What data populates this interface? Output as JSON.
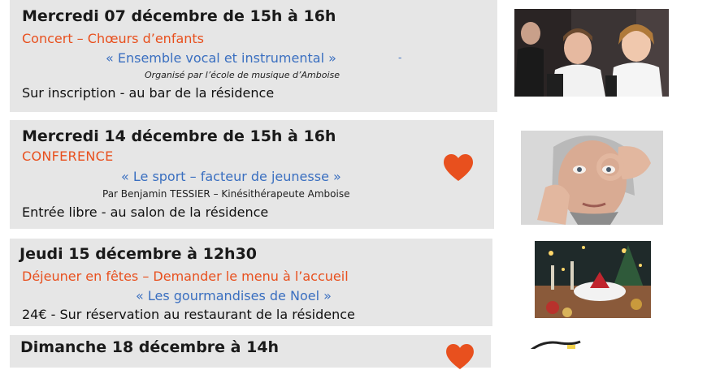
{
  "events": [
    {
      "date": "Mercredi 07 décembre de 15h à 16h",
      "subtitle": "Concert – Chœurs d’enfants",
      "quote": "« Ensemble vocal et instrumental »",
      "organizer": "Organisé par l’école de musique d’Amboise",
      "info": "Sur inscription - au bar de la résidence"
    },
    {
      "date": "Mercredi 14 décembre de 15h à 16h",
      "subtitle": "CONFERENCE",
      "quote": "« Le sport – facteur de jeunesse »",
      "organizer": "Par Benjamin TESSIER – Kinésithérapeute Amboise",
      "info": "Entrée libre - au salon de la résidence"
    },
    {
      "date": "Jeudi 15 décembre à 12h30",
      "subtitle": "Déjeuner en fêtes – Demander le menu à l’accueil",
      "quote": "« Les gourmandises de Noel »",
      "info": "24€ - Sur réservation au restaurant de la résidence"
    },
    {
      "date": "Dimanche 18 décembre à 14h"
    }
  ],
  "colors": {
    "card": "#e6e6e6",
    "accent_orange": "#e8501e",
    "accent_blue": "#3a6fc0",
    "heart": "#e8501e"
  },
  "icons": [
    "heart-icon",
    "heart-icon"
  ],
  "photos": [
    "children-choir-photo",
    "senior-woman-photo",
    "christmas-table-photo",
    "event-poster-photo"
  ]
}
